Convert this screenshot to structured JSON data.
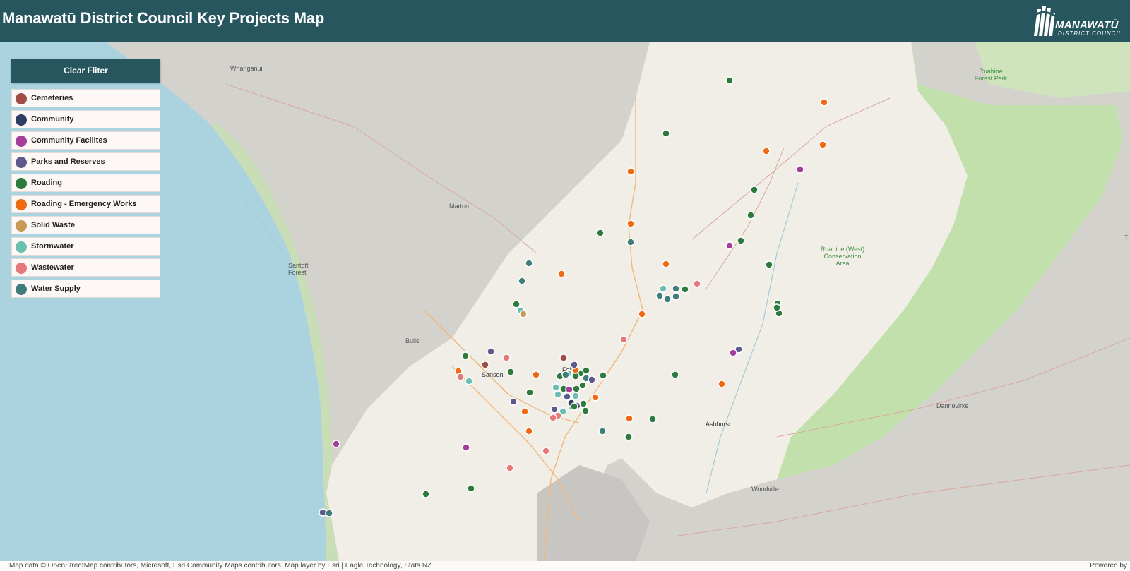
{
  "header": {
    "title": "Manawatū District Council Key Projects Map",
    "logo_name": "MANAWATŪ",
    "logo_sub": "DISTRICT COUNCIL",
    "background": "#27565f"
  },
  "filter_panel": {
    "clear_label": "Clear Fliter",
    "categories": [
      {
        "key": "cemeteries",
        "label": "Cemeteries",
        "color": "#a04e45"
      },
      {
        "key": "community",
        "label": "Community",
        "color": "#2e3d63"
      },
      {
        "key": "community_facilities",
        "label": "Community Facilites",
        "color": "#a33f9a"
      },
      {
        "key": "parks",
        "label": "Parks and Reserves",
        "color": "#5c5a8c"
      },
      {
        "key": "roading",
        "label": "Roading",
        "color": "#2c7a3c"
      },
      {
        "key": "emergency",
        "label": "Roading - Emergency Works",
        "color": "#ef6a12"
      },
      {
        "key": "solid_waste",
        "label": "Solid Waste",
        "color": "#c99a55"
      },
      {
        "key": "stormwater",
        "label": "Stormwater",
        "color": "#6abfb1"
      },
      {
        "key": "wastewater",
        "label": "Wastewater",
        "color": "#e57878"
      },
      {
        "key": "water_supply",
        "label": "Water Supply",
        "color": "#3f7d7b"
      }
    ]
  },
  "map": {
    "places": {
      "whanganui": "Whanganui",
      "marton": "Marton",
      "bulls": "Bulls",
      "santoft": "Santoft Forest",
      "sanson": "Sanson",
      "feilding": "Feil",
      "ashhurst": "Ashhurst",
      "woodville": "Woodville",
      "dannevirke": "Dannevirke",
      "ruahine_forest_park": "Ruahine Forest Park",
      "ruahine_west": "Ruahine (West) Conservation Area",
      "edge_t": "T"
    },
    "water_color": "#abd3df",
    "district_color": "#f2efe9",
    "outside_color": "#d9d6d0",
    "forest_color": "#b7dba0"
  },
  "attribution": {
    "text": "Map data © OpenStreetMap contributors, Microsoft, Esri Community Maps contributors, Map layer by Esri | Eagle Technology, Stats NZ",
    "powered_by": "Powered by"
  }
}
